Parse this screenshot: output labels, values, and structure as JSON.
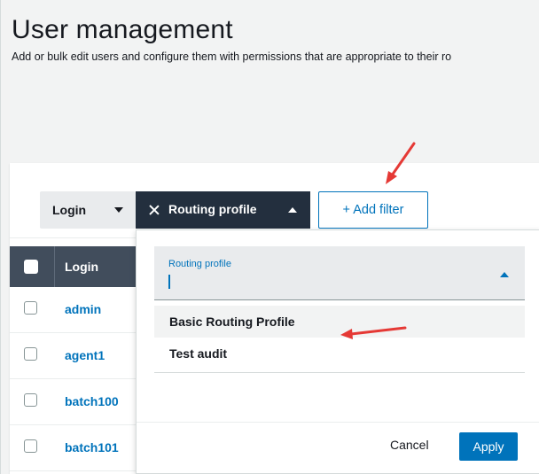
{
  "header": {
    "title": "User management",
    "description": "Add or bulk edit users and configure them with permissions that are appropriate to their ro"
  },
  "filters": {
    "login_select": "Login",
    "routing_chip": "Routing profile",
    "add_filter": "+ Add filter"
  },
  "table": {
    "column_login": "Login",
    "rows": [
      {
        "login": "admin"
      },
      {
        "login": "agent1"
      },
      {
        "login": "batch100"
      },
      {
        "login": "batch101"
      }
    ]
  },
  "dropdown": {
    "field_label": "Routing profile",
    "options": [
      "Basic Routing Profile",
      "Test audit"
    ],
    "cancel": "Cancel",
    "apply": "Apply"
  },
  "colors": {
    "accent": "#0073bb",
    "header_dark": "#232f3e",
    "annotation_arrow": "#e53935"
  }
}
